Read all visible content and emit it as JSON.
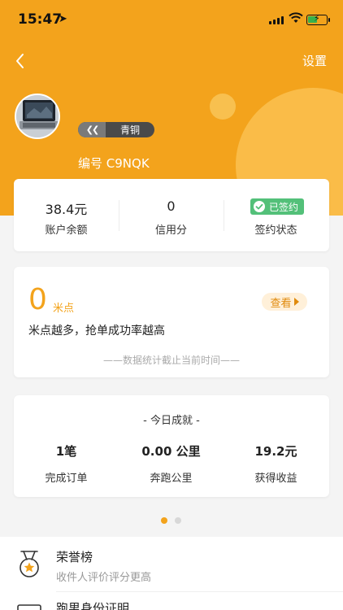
{
  "status_bar": {
    "time": "15:47",
    "location_glyph": "➤"
  },
  "nav": {
    "settings_label": "设置"
  },
  "profile": {
    "rank": "青铜",
    "user_id": "编号 C9NQK"
  },
  "account": {
    "balance_value": "38.4元",
    "balance_label": "账户余额",
    "credit_value": "0",
    "credit_label": "信用分",
    "signed_tag": "已签约",
    "sign_label": "签约状态"
  },
  "points": {
    "value": "0",
    "unit": "米点",
    "view_label": "查看",
    "description": "米点越多，抢单成功率越高",
    "note": "——数据统计截止当前时间——"
  },
  "today": {
    "title": "- 今日成就 -",
    "items": [
      {
        "value": "1笔",
        "label": "完成订单"
      },
      {
        "value": "0.00 公里",
        "label": "奔跑公里"
      },
      {
        "value": "19.2元",
        "label": "获得收益"
      }
    ]
  },
  "list": [
    {
      "title": "荣誉榜",
      "subtitle": "收件人评价评分更高",
      "icon": "medal-icon"
    },
    {
      "title": "跑男身份证明",
      "icon": "id-card-icon"
    }
  ],
  "colors": {
    "accent": "#f3a31c",
    "signed_green": "#53c079",
    "dot_active": "#f3a31c",
    "dot_inactive": "#d8d8d8"
  }
}
